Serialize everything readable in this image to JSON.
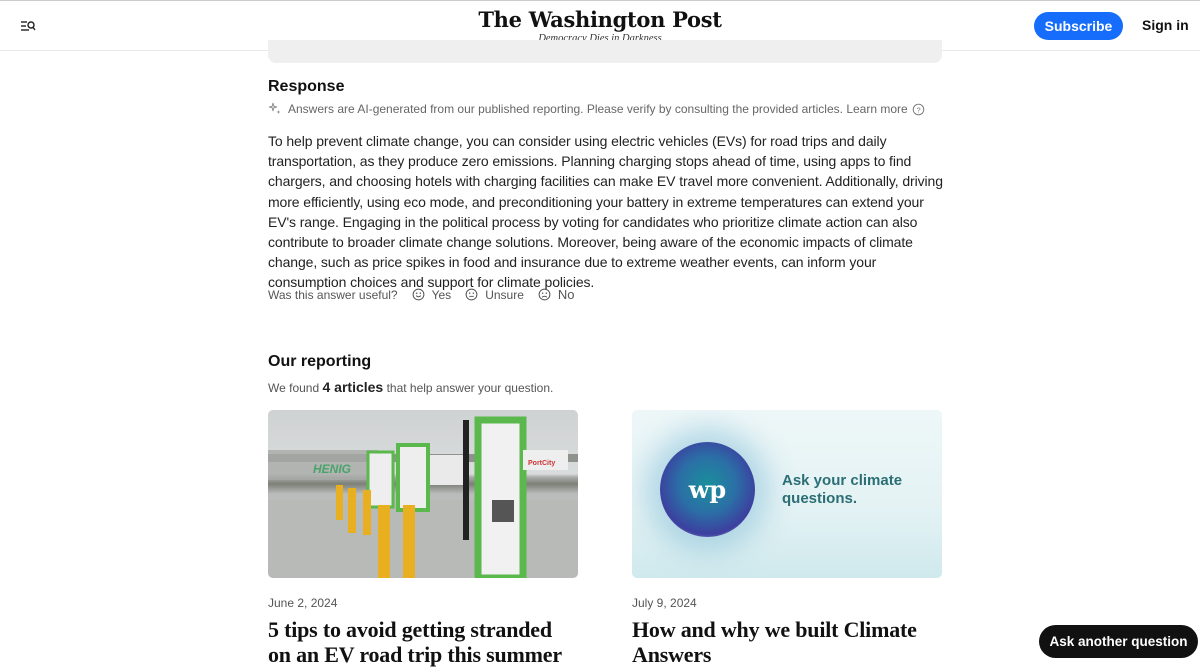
{
  "header": {
    "menu_icon": "menu-search-icon",
    "logo": "The Washington Post",
    "tagline": "Democracy Dies in Darkness",
    "subscribe_label": "Subscribe",
    "signin_label": "Sign in",
    "accent_color": "#166dfc"
  },
  "response": {
    "heading": "Response",
    "disclaimer": "Answers are AI-generated from our published reporting. Please verify by consulting the provided articles.",
    "learn_more": "Learn more",
    "answer": "To help prevent climate change, you can consider using electric vehicles (EVs) for road trips and daily transportation, as they produce zero emissions. Planning charging stops ahead of time, using apps to find chargers, and choosing hotels with charging facilities can make EV travel more convenient. Additionally, driving more efficiently, using eco mode, and preconditioning your battery in extreme temperatures can extend your EV's range. Engaging in the political process by voting for candidates who prioritize climate action can also contribute to broader climate change solutions. Moreover, being aware of the economic impacts of climate change, such as price spikes in food and insurance due to extreme weather events, can inform your consumption choices and support for climate policies.",
    "feedback": {
      "prompt": "Was this answer useful?",
      "options": [
        {
          "label": "Yes",
          "icon": "smile-icon"
        },
        {
          "label": "Unsure",
          "icon": "neutral-face-icon"
        },
        {
          "label": "No",
          "icon": "frown-icon"
        }
      ]
    }
  },
  "reporting": {
    "heading": "Our reporting",
    "found_prefix": "We found",
    "found_count": "4 articles",
    "found_suffix": "that help answer your question.",
    "articles": [
      {
        "date": "June 2, 2024",
        "headline": "5 tips to avoid getting stranded on an EV road trip this summer",
        "image": "EV charging stations with yellow bollards"
      },
      {
        "date": "July 9, 2024",
        "headline": "How and why we built Climate Answers",
        "image_logo": "wp",
        "image_text": "Ask your climate questions."
      }
    ]
  },
  "ask_button_label": "Ask another question"
}
